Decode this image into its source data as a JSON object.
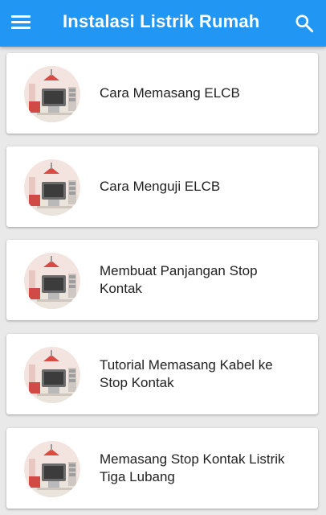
{
  "app_bar": {
    "title": "Instalasi Listrik Rumah",
    "menu_icon": "hamburger-menu-icon",
    "search_icon": "search-icon",
    "color": "#2196f3"
  },
  "list": {
    "items": [
      {
        "label": "Cara Memasang ELCB",
        "thumb_icon": "room-tv-illustration"
      },
      {
        "label": "Cara Menguji ELCB",
        "thumb_icon": "room-tv-illustration"
      },
      {
        "label": "Membuat Panjangan Stop Kontak",
        "thumb_icon": "room-tv-illustration"
      },
      {
        "label": "Tutorial Memasang Kabel ke Stop Kontak",
        "thumb_icon": "room-tv-illustration"
      },
      {
        "label": "Memasang Stop Kontak Listrik Tiga Lubang",
        "thumb_icon": "room-tv-illustration"
      }
    ]
  }
}
